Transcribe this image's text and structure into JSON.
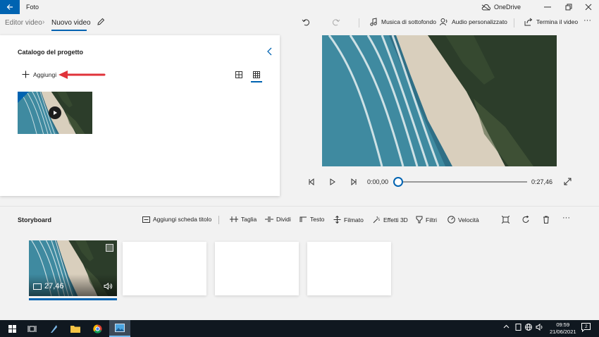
{
  "titlebar": {
    "app_title": "Foto",
    "onedrive_label": "OneDrive"
  },
  "breadcrumb": {
    "parent": "Editor video",
    "separator": "›",
    "current": "Nuovo video"
  },
  "toolbar": {
    "background_music": "Musica di sottofondo",
    "custom_audio": "Audio personalizzato",
    "finish_video": "Termina il video",
    "more": "···"
  },
  "library": {
    "title": "Catalogo del progetto",
    "add_label": "Aggiungi"
  },
  "player": {
    "current_time": "0:00,00",
    "total_time": "0:27,46",
    "progress": 0
  },
  "storyboard": {
    "title": "Storyboard",
    "tools": {
      "title_card": "Aggiungi scheda titolo",
      "trim": "Taglia",
      "split": "Dividi",
      "text": "Testo",
      "motion": "Filmato",
      "effects3d": "Effetti 3D",
      "filters": "Filtri",
      "speed": "Velocità",
      "more": "···"
    },
    "clip": {
      "duration": "27,46"
    }
  },
  "taskbar": {
    "time": "09:59",
    "date": "21/06/2021",
    "notifications": "2"
  },
  "colors": {
    "accent": "#0063b1",
    "arrow": "#e0333a"
  }
}
